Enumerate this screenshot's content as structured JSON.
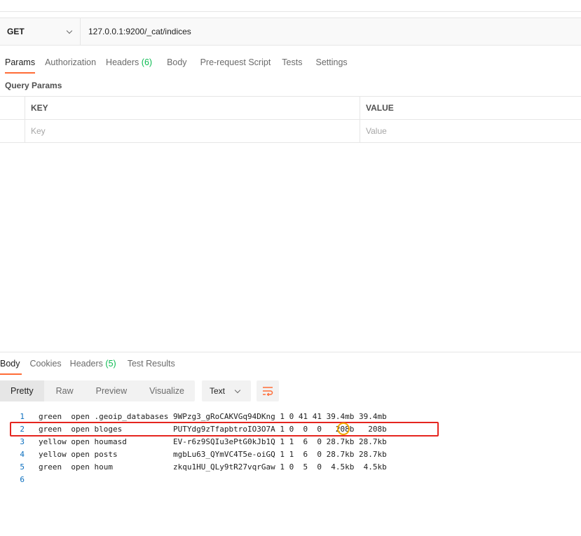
{
  "request": {
    "method": "GET",
    "url": "127.0.0.1:9200/_cat/indices"
  },
  "request_tabs": [
    {
      "label": "Params",
      "active": true
    },
    {
      "label": "Authorization"
    },
    {
      "label": "Headers",
      "count": "(6)"
    },
    {
      "label": "Body"
    },
    {
      "label": "Pre-request Script"
    },
    {
      "label": "Tests"
    },
    {
      "label": "Settings"
    }
  ],
  "query_params": {
    "title": "Query Params",
    "key_header": "KEY",
    "value_header": "VALUE",
    "key_placeholder": "Key",
    "value_placeholder": "Value"
  },
  "response_tabs": [
    {
      "label": "Body",
      "active": true
    },
    {
      "label": "Cookies"
    },
    {
      "label": "Headers",
      "count": "(5)"
    },
    {
      "label": "Test Results"
    }
  ],
  "view_modes": [
    "Pretty",
    "Raw",
    "Preview",
    "Visualize"
  ],
  "format": "Text",
  "wrap_icon": "wrap-lines-icon",
  "response_lines": [
    {
      "n": "1",
      "text": "green  open .geoip_databases 9WPzg3_gRoCAKVGq94DKng 1 0 41 41 39.4mb 39.4mb"
    },
    {
      "n": "2",
      "text": "green  open bloges           PUTYdg9zTfapbtroIO3O7A 1 0  0  0   208b   208b"
    },
    {
      "n": "3",
      "text": "yellow open houmasd          EV-r6z9SQIu3ePtG0kJb1Q 1 1  6  0 28.7kb 28.7kb"
    },
    {
      "n": "4",
      "text": "yellow open posts            mgbLu63_QYmVC4T5e-oiGQ 1 1  6  0 28.7kb 28.7kb"
    },
    {
      "n": "5",
      "text": "green  open houm             zkqu1HU_QLy9tR27vqrGaw 1 0  5  0  4.5kb  4.5kb"
    },
    {
      "n": "6",
      "text": ""
    }
  ],
  "colors": {
    "accent": "#ff6c37",
    "count_green": "#0cbb52",
    "highlight_box": "#e5251f",
    "highlight_circle": "#f2a900",
    "line_number": "#0c6fbf"
  }
}
